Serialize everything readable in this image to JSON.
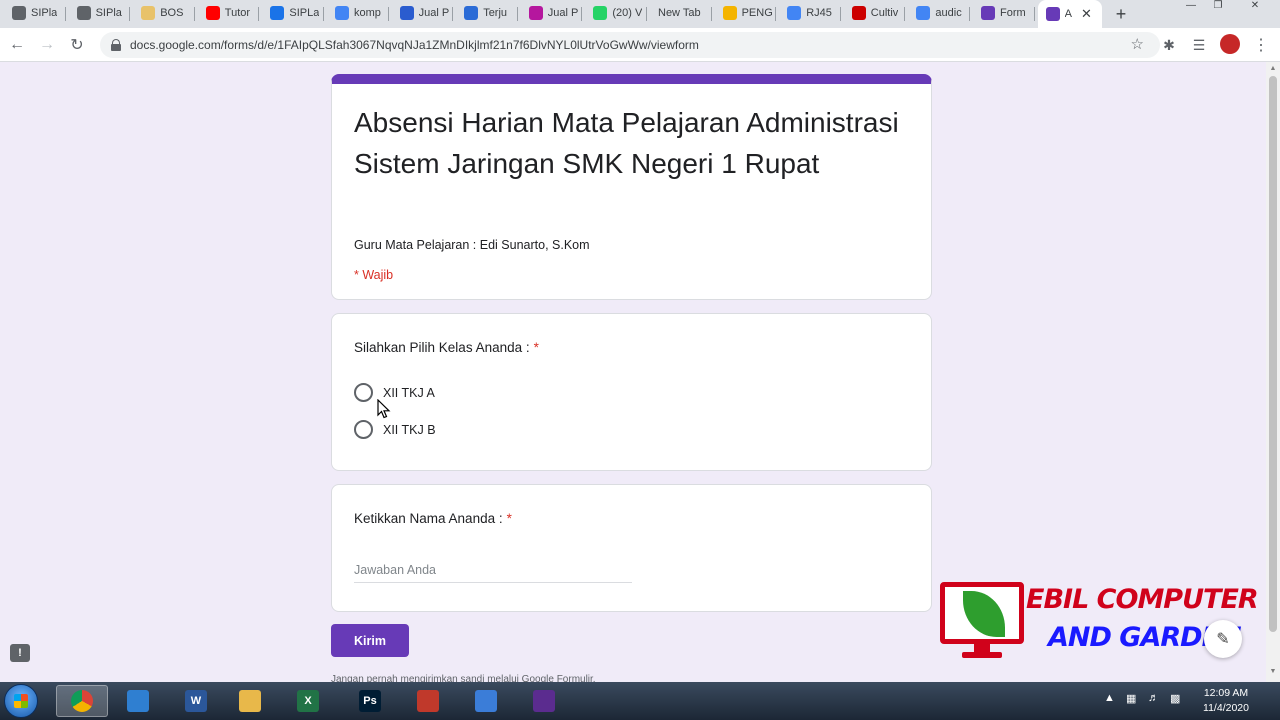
{
  "browser": {
    "tabs": [
      {
        "title": "SIPla",
        "icon": "google-icon",
        "color": "#5f6368"
      },
      {
        "title": "SIPla",
        "icon": "google-icon",
        "color": "#5f6368"
      },
      {
        "title": "BOS",
        "icon": "bos-icon",
        "color": "#e8c26a"
      },
      {
        "title": "Tutor",
        "icon": "youtube-icon",
        "color": "#ff0000"
      },
      {
        "title": "SIPLa",
        "icon": "siplah-icon",
        "color": "#1a73e8"
      },
      {
        "title": "komp",
        "icon": "google-search-icon",
        "color": "#4285f4"
      },
      {
        "title": "Jual P",
        "icon": "edge-e-icon",
        "color": "#2a5ccf"
      },
      {
        "title": "Terju",
        "icon": "k-icon",
        "color": "#2b6bd6"
      },
      {
        "title": "Jual P",
        "icon": "shopee-icon",
        "color": "#b5179e"
      },
      {
        "title": "(20) V",
        "icon": "whatsapp-icon",
        "color": "#25d366"
      },
      {
        "title": "New Tab",
        "icon": "none",
        "color": ""
      },
      {
        "title": "PENG",
        "icon": "star-icon",
        "color": "#f4b400"
      },
      {
        "title": "RJ45",
        "icon": "google-search-icon",
        "color": "#4285f4"
      },
      {
        "title": "Cultiv",
        "icon": "red-app-icon",
        "color": "#cc0000"
      },
      {
        "title": "audic",
        "icon": "google-search-icon",
        "color": "#4285f4"
      },
      {
        "title": "Form",
        "icon": "forms-icon",
        "color": "#673ab7"
      }
    ],
    "active_tab": {
      "title": "A",
      "icon": "forms-icon",
      "color": "#673ab7"
    },
    "url": "docs.google.com/forms/d/e/1FAIpQLSfah3067NqvqNJa1ZMnDIkjlmf21n7f6DlvNYL0lUtrVoGwWw/viewform"
  },
  "form": {
    "accent_color": "#673ab7",
    "title": "Absensi Harian Mata Pelajaran Administrasi Sistem Jaringan SMK Negeri 1 Rupat",
    "description": "Guru Mata Pelajaran : Edi Sunarto, S.Kom",
    "required_note": "* Wajib",
    "questions": [
      {
        "title": "Silahkan Pilih Kelas Ananda :",
        "required_mark": "*",
        "options": [
          "XII TKJ A",
          "XII TKJ B"
        ]
      },
      {
        "title": "Ketikkan Nama Ananda :",
        "required_mark": "*",
        "placeholder": "Jawaban Anda",
        "value": ""
      }
    ],
    "submit_label": "Kirim",
    "footer_note": "Jangan pernah mengirimkan sandi melalui Google Formulir."
  },
  "watermark": {
    "line1": "EBIL COMPUTER",
    "line2": "AND GARDEN"
  },
  "taskbar": {
    "apps": [
      {
        "name": "chrome",
        "label": "",
        "color": "#db4437"
      },
      {
        "name": "control-panel",
        "label": "",
        "color": "#2f7fd1"
      },
      {
        "name": "word",
        "label": "W",
        "color": "#2b579a"
      },
      {
        "name": "explorer",
        "label": "",
        "color": "#e8b84a"
      },
      {
        "name": "excel",
        "label": "X",
        "color": "#217346"
      },
      {
        "name": "photoshop",
        "label": "Ps",
        "color": "#001d34"
      },
      {
        "name": "snipping-tool",
        "label": "",
        "color": "#c0392b"
      },
      {
        "name": "network-app",
        "label": "",
        "color": "#3b7dd8"
      },
      {
        "name": "media-player",
        "label": "",
        "color": "#5b2c8f"
      }
    ],
    "time": "12:09 AM",
    "date": "11/4/2020"
  }
}
